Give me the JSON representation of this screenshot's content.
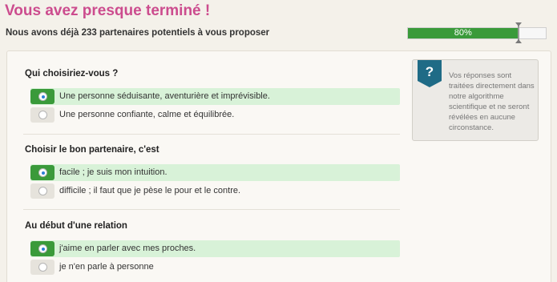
{
  "header": {
    "title": "Vous avez presque terminé !",
    "subtitle": "Nous avons déjà 233 partenaires potentiels à vous proposer"
  },
  "progress": {
    "value": 0.8,
    "label": "80%",
    "marker": 0.8,
    "fill_color": "#3a9a3a"
  },
  "info": {
    "icon": "question-icon",
    "text": "Vos réponses sont traitées directement dans notre algorithme scientifique et ne seront révélées en aucune circonstance."
  },
  "questions": [
    {
      "title": "Qui choisiriez-vous ?",
      "options": [
        {
          "label": "Une personne séduisante, aventurière et imprévisible.",
          "selected": true
        },
        {
          "label": "Une personne confiante, calme et équilibrée.",
          "selected": false
        }
      ]
    },
    {
      "title": "Choisir le bon partenaire, c'est",
      "options": [
        {
          "label": "facile ; je suis mon intuition.",
          "selected": true
        },
        {
          "label": "difficile ; il faut que je pèse le pour et le contre.",
          "selected": false
        }
      ]
    },
    {
      "title": "Au début d'une relation",
      "options": [
        {
          "label": "j'aime en parler avec mes proches.",
          "selected": true
        },
        {
          "label": "je n'en parle à personne",
          "selected": false
        }
      ]
    }
  ],
  "colors": {
    "title": "#cc4c8e",
    "selected_bg": "#d8f2d8",
    "accent_green": "#3a9a3a",
    "info_badge": "#1f6b86"
  }
}
